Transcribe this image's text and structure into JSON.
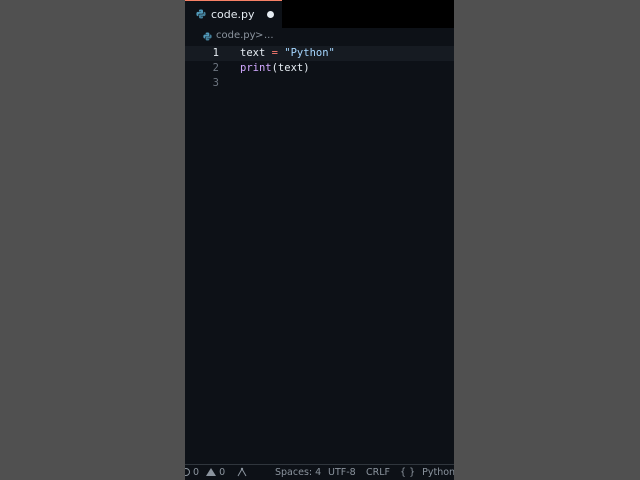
{
  "tab": {
    "filename": "code.py",
    "modified": true
  },
  "breadcrumb": {
    "file": "code.py",
    "separator": ">",
    "more": "..."
  },
  "editor": {
    "lines": [
      {
        "number": "1",
        "tokens": [
          {
            "t": "text",
            "c": "var"
          },
          {
            "t": " ",
            "c": "var"
          },
          {
            "t": "=",
            "c": "op"
          },
          {
            "t": " ",
            "c": "var"
          },
          {
            "t": "\"Python\"",
            "c": "str"
          }
        ]
      },
      {
        "number": "2",
        "tokens": [
          {
            "t": "print",
            "c": "fn"
          },
          {
            "t": "(text)",
            "c": "var"
          }
        ]
      },
      {
        "number": "3",
        "tokens": []
      }
    ],
    "current_line": 1
  },
  "statusbar": {
    "errors": "0",
    "warnings": "0",
    "spaces": "Spaces: 4",
    "encoding": "UTF-8",
    "eol": "CRLF",
    "language_icon": "{ }",
    "language": "Python"
  },
  "colors": {
    "background": "#0d1117",
    "outer": "#505050",
    "keyword": "#ff7b72",
    "string": "#a5d6ff",
    "function": "#d2a8ff"
  }
}
